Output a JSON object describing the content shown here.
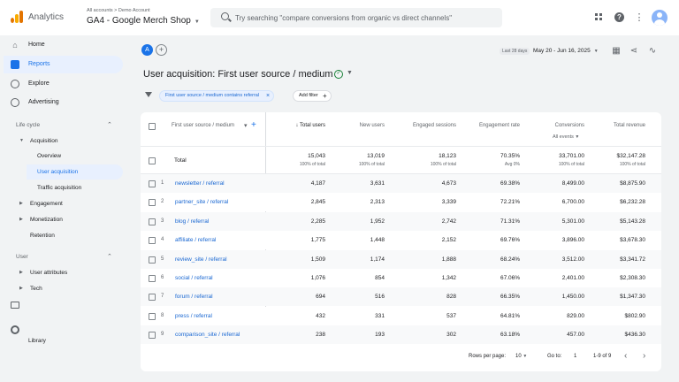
{
  "app": {
    "name": "Analytics",
    "breadcrumb": "All accounts > Demo Account",
    "property": "GA4 - Google Merch Shop"
  },
  "search": {
    "placeholder": "Try searching \"compare conversions from organic vs direct channels\""
  },
  "sidebar": {
    "items": [
      {
        "label": "Home",
        "icon": "home-icon"
      },
      {
        "label": "Reports",
        "icon": "reports-icon"
      },
      {
        "label": "Explore",
        "icon": "explore-icon"
      },
      {
        "label": "Advertising",
        "icon": "advertising-icon"
      }
    ],
    "lifecycle": {
      "title": "Life cycle",
      "acquisition": "Acquisition",
      "overview": "Overview",
      "user_acquisition": "User acquisition",
      "traffic_acquisition": "Traffic acquisition",
      "engagement": "Engagement",
      "monetization": "Monetization",
      "retention": "Retention"
    },
    "user": {
      "title": "User",
      "user_attributes": "User attributes",
      "tech": "Tech"
    },
    "library": "Library"
  },
  "header": {
    "avatar_letter": "A",
    "date_badge": "Last 28 days",
    "date_range": "May 20 - Jun 16, 2025",
    "title": "User acquisition: First user source / medium"
  },
  "filters": {
    "chip": "First user source / medium contains referral",
    "add_filter": "Add filter"
  },
  "table": {
    "dimension_header": "First user source / medium",
    "columns": [
      "Total users",
      "New users",
      "Engaged sessions",
      "Engagement rate",
      "Conversions",
      "Total revenue"
    ],
    "conversions_sub": "All events",
    "sort_indicator": "↓",
    "totals": {
      "label": "Total",
      "values": [
        "15,043",
        "13,019",
        "18,123",
        "70.35%",
        "33,701.00",
        "$32,147.28"
      ],
      "subs": [
        "100% of total",
        "100% of total",
        "100% of total",
        "Avg 0%",
        "100% of total",
        "100% of total"
      ]
    },
    "rows": [
      {
        "num": "1",
        "source": "newsletter / referral",
        "values": [
          "4,187",
          "3,631",
          "4,673",
          "69.38%",
          "8,499.00",
          "$8,875.90"
        ]
      },
      {
        "num": "2",
        "source": "partner_site / referral",
        "values": [
          "2,845",
          "2,313",
          "3,339",
          "72.21%",
          "6,700.00",
          "$6,232.28"
        ]
      },
      {
        "num": "3",
        "source": "blog / referral",
        "values": [
          "2,285",
          "1,952",
          "2,742",
          "71.31%",
          "5,301.00",
          "$5,143.28"
        ]
      },
      {
        "num": "4",
        "source": "affiliate / referral",
        "values": [
          "1,775",
          "1,448",
          "2,152",
          "69.76%",
          "3,896.00",
          "$3,678.30"
        ]
      },
      {
        "num": "5",
        "source": "review_site / referral",
        "values": [
          "1,509",
          "1,174",
          "1,888",
          "68.24%",
          "3,512.00",
          "$3,341.72"
        ]
      },
      {
        "num": "6",
        "source": "social / referral",
        "values": [
          "1,076",
          "854",
          "1,342",
          "67.06%",
          "2,401.00",
          "$2,308.30"
        ]
      },
      {
        "num": "7",
        "source": "forum / referral",
        "values": [
          "694",
          "516",
          "828",
          "66.35%",
          "1,450.00",
          "$1,347.30"
        ]
      },
      {
        "num": "8",
        "source": "press / referral",
        "values": [
          "432",
          "331",
          "537",
          "64.81%",
          "829.00",
          "$802.90"
        ]
      },
      {
        "num": "9",
        "source": "comparison_site / referral",
        "values": [
          "238",
          "193",
          "302",
          "63.18%",
          "457.00",
          "$436.30"
        ]
      }
    ]
  },
  "pagination": {
    "rows_per_page_label": "Rows per page:",
    "rows_per_page": "10",
    "goto_label": "Go to:",
    "goto_value": "1",
    "range": "1-9 of 9"
  },
  "colors": {
    "accent": "#1a73e8",
    "link": "#1967d2",
    "logo_orange": "#e37400",
    "logo_yellow": "#f9ab00"
  }
}
